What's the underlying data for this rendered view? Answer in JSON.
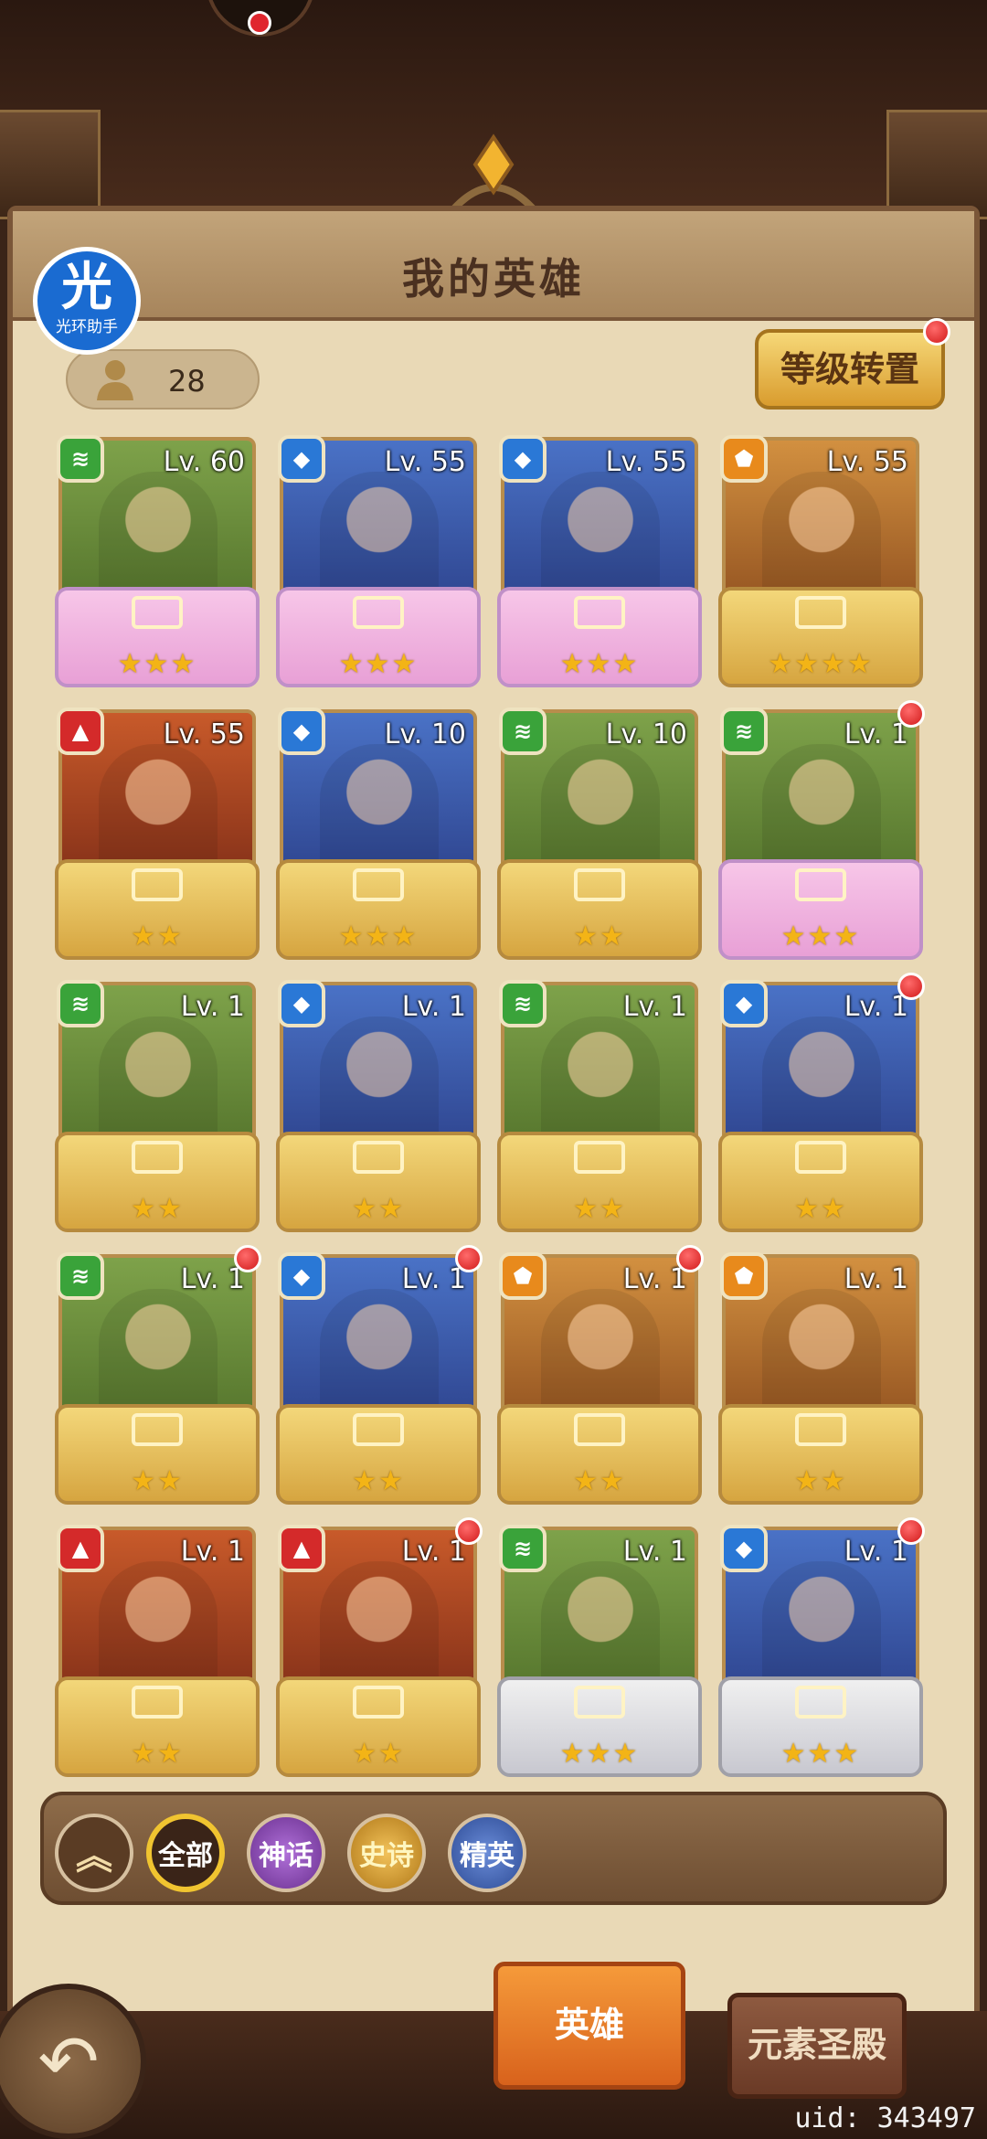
{
  "panel": {
    "title": "我的英雄"
  },
  "assistant": {
    "icon_char": "光",
    "label": "光环助手"
  },
  "hero_count": "28",
  "level_transfer_button": "等级转置",
  "heroes": [
    {
      "element": "nature",
      "level": "Lv. 60",
      "stars": "★★★",
      "frame": "pink",
      "new": false
    },
    {
      "element": "water",
      "level": "Lv. 55",
      "stars": "★★★",
      "frame": "pink",
      "new": false
    },
    {
      "element": "water",
      "level": "Lv. 55",
      "stars": "★★★",
      "frame": "pink",
      "new": false
    },
    {
      "element": "earth",
      "level": "Lv. 55",
      "stars": "★★★★",
      "frame": "gold",
      "new": false
    },
    {
      "element": "fire",
      "level": "Lv. 55",
      "stars": "★★",
      "frame": "gold",
      "new": false
    },
    {
      "element": "water",
      "level": "Lv. 10",
      "stars": "★★★",
      "frame": "gold",
      "new": false
    },
    {
      "element": "nature",
      "level": "Lv. 10",
      "stars": "★★",
      "frame": "gold",
      "new": false
    },
    {
      "element": "nature",
      "level": "Lv. 1",
      "stars": "★★★",
      "frame": "pink",
      "new": true
    },
    {
      "element": "nature",
      "level": "Lv. 1",
      "stars": "★★",
      "frame": "gold",
      "new": false
    },
    {
      "element": "water",
      "level": "Lv. 1",
      "stars": "★★",
      "frame": "gold",
      "new": false
    },
    {
      "element": "nature",
      "level": "Lv. 1",
      "stars": "★★",
      "frame": "gold",
      "new": false
    },
    {
      "element": "water",
      "level": "Lv. 1",
      "stars": "★★",
      "frame": "gold",
      "new": true
    },
    {
      "element": "nature",
      "level": "Lv. 1",
      "stars": "★★",
      "frame": "gold",
      "new": true
    },
    {
      "element": "water",
      "level": "Lv. 1",
      "stars": "★★",
      "frame": "gold",
      "new": true
    },
    {
      "element": "earth",
      "level": "Lv. 1",
      "stars": "★★",
      "frame": "gold",
      "new": true
    },
    {
      "element": "earth",
      "level": "Lv. 1",
      "stars": "★★",
      "frame": "gold",
      "new": false
    },
    {
      "element": "fire",
      "level": "Lv. 1",
      "stars": "★★",
      "frame": "gold",
      "new": false
    },
    {
      "element": "fire",
      "level": "Lv. 1",
      "stars": "★★",
      "frame": "gold",
      "new": true
    },
    {
      "element": "nature",
      "level": "Lv. 1",
      "stars": "★★★",
      "frame": "silver",
      "new": false
    },
    {
      "element": "water",
      "level": "Lv. 1",
      "stars": "★★★",
      "frame": "silver",
      "new": true
    }
  ],
  "filters": {
    "collapse_icon": "︽",
    "all": "全部",
    "myth": "神话",
    "epic": "史诗",
    "elite": "精英"
  },
  "bottom_tabs": {
    "heroes": "英雄",
    "element_temple": "元素圣殿"
  },
  "back_icon": "↶",
  "uid": "uid: 343497",
  "colors": {
    "panel_bg": "#e9d9b6",
    "active_tab": "#f59a3a",
    "new_badge": "#d11a1a"
  }
}
